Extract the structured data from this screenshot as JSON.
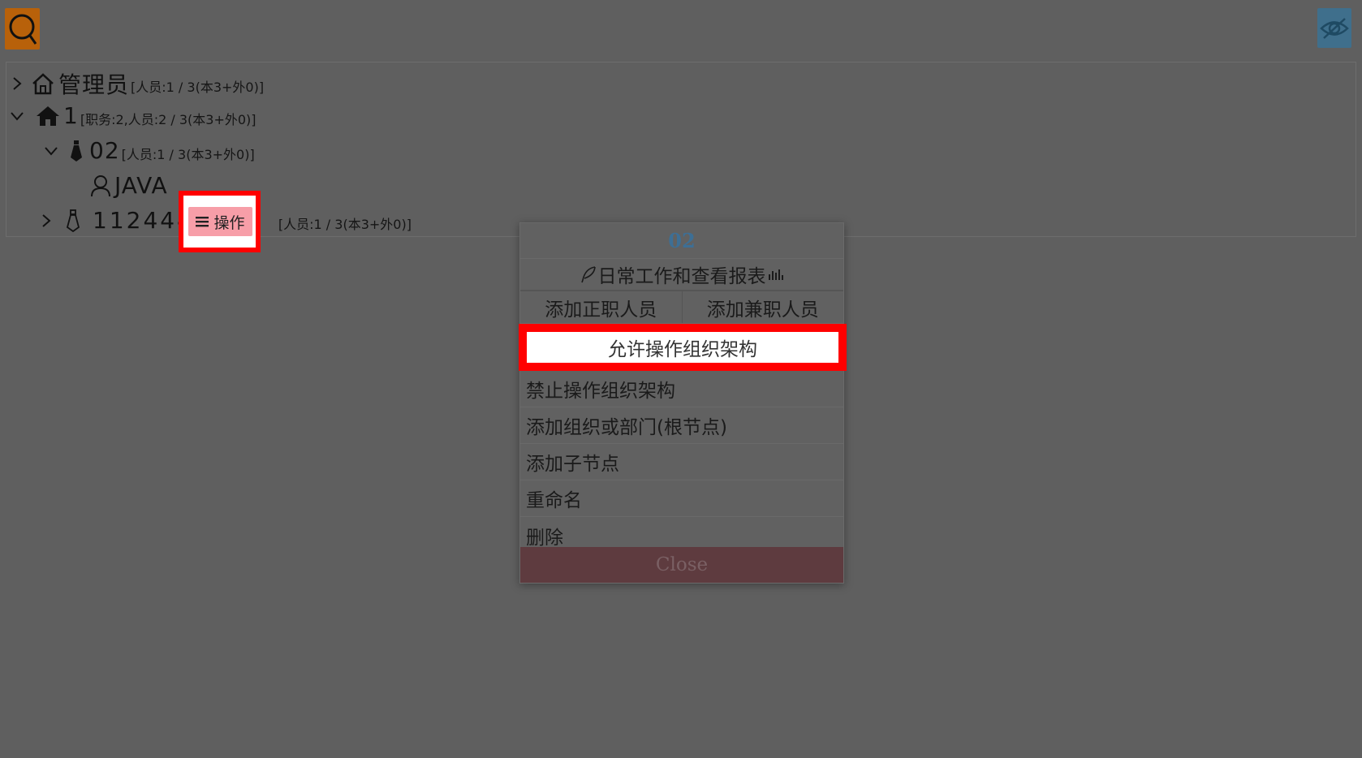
{
  "toolbar": {
    "search_icon": "search-icon",
    "visibility_icon": "eye-slash-icon"
  },
  "tree": {
    "nodes": [
      {
        "name": "管理员",
        "meta": "[人员:1 / 3(本3+外0)]",
        "icon": "home-outline-icon",
        "expanded": false
      },
      {
        "name": "1",
        "meta": "[职务:2,人员:2 / 3(本3+外0)]",
        "icon": "home-solid-icon",
        "expanded": true
      },
      {
        "name": "02",
        "meta": "[人员:1 / 3(本3+外0)]",
        "icon": "tie-solid-icon",
        "expanded": true
      },
      {
        "name": "JAVA",
        "meta": "",
        "icon": "user-icon",
        "expanded": null
      },
      {
        "name": "112444",
        "meta": "[人员:1 / 3(本3+外0)]",
        "icon": "tie-outline-icon",
        "expanded": false
      }
    ],
    "operate_label": "操作"
  },
  "menu": {
    "title": "02",
    "daily_work": "日常工作和查看报表",
    "add_fulltime": "添加正职人员",
    "add_parttime": "添加兼职人员",
    "allow_operate": "允许操作组织架构",
    "items": [
      "禁止操作组织架构",
      "添加组织或部门(根节点)",
      "添加子节点",
      "重命名",
      "删除"
    ],
    "close": "Close"
  },
  "colors": {
    "overlay_bg": "#5f5f5f",
    "search_btn": "#b8610a",
    "eye_btn": "#3f6f8c",
    "operate_btn": "#f79ea8",
    "highlight": "#ff0000",
    "menu_title": "#3d6f95",
    "close_bg": "#5e3b3f"
  }
}
